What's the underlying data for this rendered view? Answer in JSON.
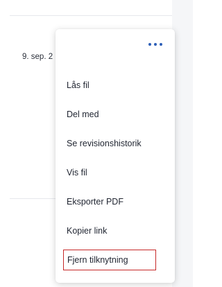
{
  "background": {
    "date_cell": "9. sep. 2"
  },
  "menu": {
    "more_icon": "more-horizontal-icon",
    "items": [
      {
        "label": "Lås fil"
      },
      {
        "label": "Del med"
      },
      {
        "label": "Se revisionshistorik"
      },
      {
        "label": "Vis fil"
      },
      {
        "label": "Eksporter PDF"
      },
      {
        "label": "Kopier link"
      },
      {
        "label": "Fjern tilknytning"
      }
    ],
    "highlight_color": "#c62828",
    "accent_color": "#2d5fb7"
  }
}
